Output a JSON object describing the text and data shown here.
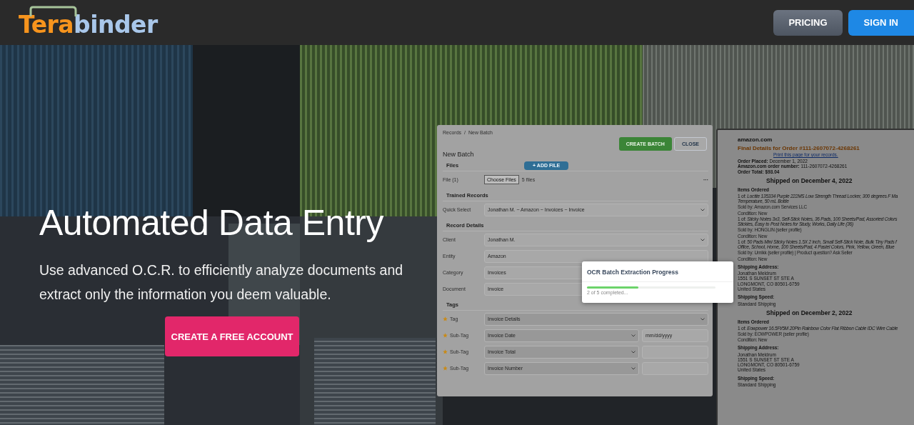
{
  "header": {
    "logo": {
      "first": "Tera",
      "second": "binder"
    },
    "nav_buttons": [
      {
        "label": "PRICING",
        "kind": "secondary"
      },
      {
        "label": "SIGN IN",
        "kind": "primary"
      }
    ]
  },
  "hero": {
    "title": "Automated Data Entry",
    "subtitle": "Use advanced O.C.R. to efficiently analyze documents and extract only the information you deem valuable.",
    "cta": "CREATE A FREE ACCOUNT"
  },
  "app_screenshot": {
    "breadcrumb": [
      "Records",
      "New Batch"
    ],
    "breadcrumb_separator": "/",
    "buttons": [
      {
        "label": "CREATE BATCH",
        "kind": "primary"
      },
      {
        "label": "CLOSE",
        "kind": "outline"
      }
    ],
    "heading": "New Batch",
    "files": {
      "title": "Files",
      "add_button": "+ ADD FILE",
      "label": "File (1)",
      "choose_button": "Choose Files",
      "status": "5 files",
      "more": "···"
    },
    "trained_records": {
      "title": "Trained Records",
      "label": "Quick Select",
      "value": "Jonathan M. ~ Amazon ~ Invoices ~ Invoice"
    },
    "record_details": {
      "title": "Record Details",
      "fields": [
        {
          "label": "Client",
          "value": "Jonathan M."
        },
        {
          "label": "Entity",
          "value": "Amazon"
        },
        {
          "label": "Category",
          "value": "Invoices"
        },
        {
          "label": "Document",
          "value": "Invoice"
        }
      ]
    },
    "tags": {
      "title": "Tags",
      "rows": [
        {
          "kind": "tag",
          "label": "Tag",
          "value": "Invoice Details"
        },
        {
          "kind": "subtag",
          "label": "Sub-Tag",
          "value": "Invoice Date",
          "placeholder": "mm/dd/yyyy"
        },
        {
          "kind": "subtag",
          "label": "Sub-Tag",
          "value": "Invoice Total"
        },
        {
          "kind": "subtag",
          "label": "Sub-Tag",
          "value": "Invoice Number"
        }
      ]
    }
  },
  "progress": {
    "title": "OCR Batch Extraction Progress",
    "level": 0.4,
    "status": "2 of 5 completed..."
  },
  "invoice": {
    "blocks": [
      {
        "kind": "brand",
        "lines": [
          "amazon.com"
        ]
      },
      {
        "kind": "title",
        "lines": [
          "Final Details for Order #111-2607072-4268261"
        ]
      },
      {
        "kind": "link",
        "lines": [
          "Print this page for your records."
        ]
      },
      {
        "kind": "text",
        "lines": [
          "**Order Placed:** December 1, 2022",
          "**Amazon.com order number:** 111-2607072-4268261",
          "**Order Total: $93.04**"
        ]
      },
      {
        "kind": "heading",
        "lines": [
          "Shipped on December 4, 2022"
        ]
      },
      {
        "kind": "subhead",
        "lines": [
          "Items Ordered"
        ]
      },
      {
        "kind": "item",
        "lines": [
          "1 of: *Loctite 135334 Purple 222MS Low Strength Thread Locker, 300 degrees F Ma*",
          "*Temperature, 50 mL Bottle*"
        ]
      },
      {
        "kind": "small",
        "lines": [
          "Sold by: Amazon.com Services LLC"
        ]
      },
      {
        "kind": "small",
        "lines": [
          "Condition: New"
        ]
      },
      {
        "kind": "item",
        "lines": [
          "1 of: *Sticky Notes 3x3, Self-Stick Notes, 36 Pads, 100 Sheets/Pad, Assorted Colors*",
          "*Stickies, Easy to Post Notes for Study, Works, Daily Life (36)*"
        ]
      },
      {
        "kind": "small",
        "lines": [
          "Sold by: HONGLIN (seller profile)"
        ]
      },
      {
        "kind": "small",
        "lines": [
          "Condition: New"
        ]
      },
      {
        "kind": "item",
        "lines": [
          "1 of: *50 Pads Mini Sticky Notes 1.5X 2 inch, Small Self-Stick Note, Bulk Tiny Pads f*",
          "*Office, School, Home, 100 Sheets/Pad, 4 Pastel Colors, Pink, Yellow, Green, Blue*"
        ]
      },
      {
        "kind": "small",
        "lines": [
          "Sold by: Umikk (seller profile) | Product question? Ask Seller"
        ]
      },
      {
        "kind": "small",
        "lines": [
          "Condition: New"
        ]
      },
      {
        "kind": "subhead",
        "lines": [
          "Shipping Address:"
        ]
      },
      {
        "kind": "text",
        "lines": [
          "Jonathan Meldrum",
          "1551 S SUNSET ST STE A",
          "LONGMONT, CO 80501-6759",
          "United States"
        ]
      },
      {
        "kind": "subhead",
        "lines": [
          "Shipping Speed:"
        ]
      },
      {
        "kind": "text",
        "lines": [
          "Standard Shipping"
        ]
      },
      {
        "kind": "heading",
        "lines": [
          "Shipped on December 2, 2022"
        ]
      },
      {
        "kind": "subhead",
        "lines": [
          "Items Ordered"
        ]
      },
      {
        "kind": "item",
        "lines": [
          "1 of: *Eowpower 16.5Ft/5M 20Pin Rainbow Color Flat Ribbon Cable IDC Wire Cable*"
        ]
      },
      {
        "kind": "small",
        "lines": [
          "Sold by: EOWPOWER (seller profile)"
        ]
      },
      {
        "kind": "small",
        "lines": [
          "Condition: New"
        ]
      },
      {
        "kind": "subhead",
        "lines": [
          "Shipping Address:"
        ]
      },
      {
        "kind": "text",
        "lines": [
          "Jonathan Meldrum",
          "1551 S SUNSET ST STE A",
          "LONGMONT, CO 80501-6759",
          "United States"
        ]
      },
      {
        "kind": "subhead",
        "lines": [
          "Shipping Speed:"
        ]
      },
      {
        "kind": "text",
        "lines": [
          "Standard Shipping"
        ]
      }
    ]
  }
}
